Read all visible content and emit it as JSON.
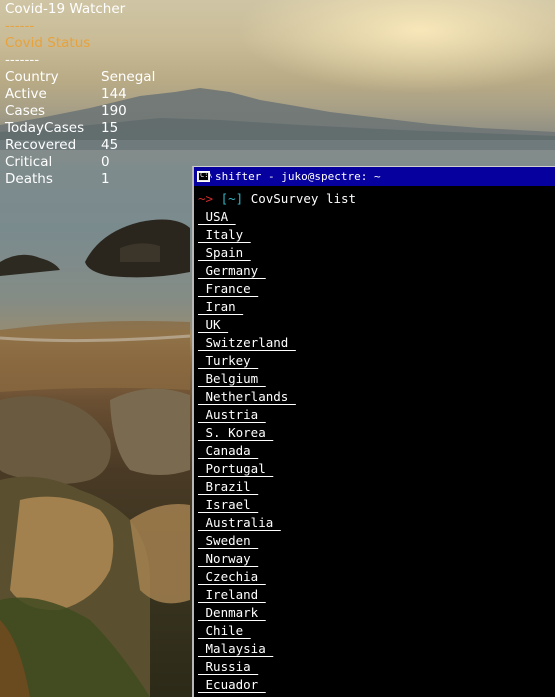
{
  "conky": {
    "title": "Covid-19  Watcher",
    "dash1": " ------",
    "status": " Covid  Status",
    "dash2": " -------",
    "rows": [
      {
        "key": "Country",
        "value": "Senegal"
      },
      {
        "key": "Active",
        "value": "144"
      },
      {
        "key": "Cases",
        "value": "190"
      },
      {
        "key": "TodayCases",
        "value": "15"
      },
      {
        "key": "Recovered",
        "value": "45"
      },
      {
        "key": "Critical",
        "value": "0"
      },
      {
        "key": "Deaths",
        "value": "1"
      }
    ]
  },
  "terminal": {
    "title": "shifter - juko@spectre: ~",
    "icon_text": "C:\\",
    "prompt_arrow": "~>",
    "prompt_dir": "[~]",
    "command": "CovSurvey list",
    "countries": [
      " USA ",
      " Italy ",
      " Spain ",
      " Germany ",
      " France ",
      " Iran ",
      " UK ",
      " Switzerland ",
      " Turkey ",
      " Belgium ",
      " Netherlands ",
      " Austria ",
      " S. Korea ",
      " Canada ",
      " Portugal ",
      " Brazil ",
      " Israel ",
      " Australia ",
      " Sweden ",
      " Norway ",
      " Czechia ",
      " Ireland ",
      " Denmark ",
      " Chile ",
      " Malaysia ",
      " Russia ",
      " Ecuador "
    ]
  },
  "colors": {
    "titlebar": "#05009e",
    "prompt_arrow": "#d42c2c",
    "prompt_dir": "#35b7c5",
    "status": "#e8a23b"
  }
}
